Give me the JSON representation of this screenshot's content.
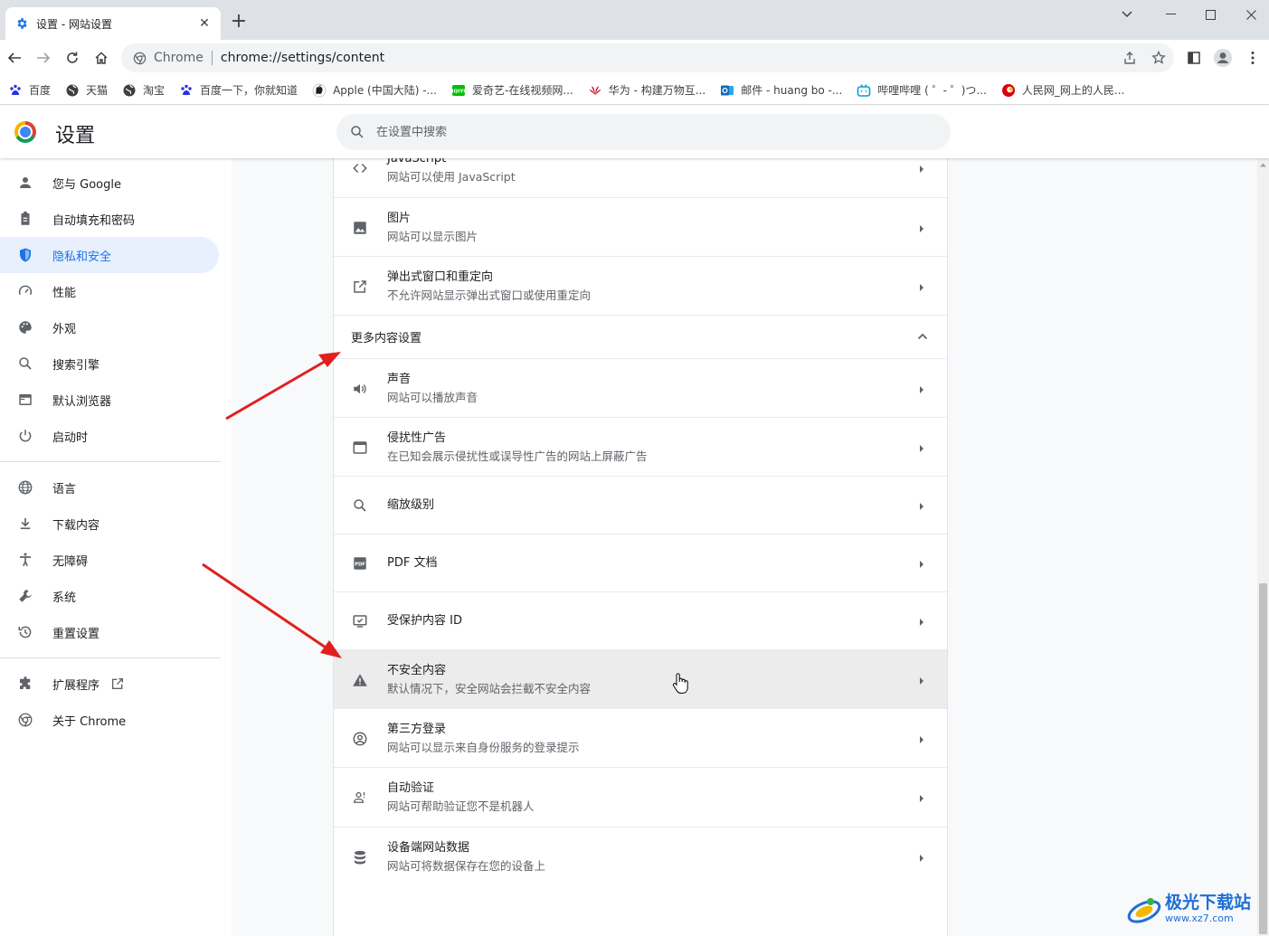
{
  "tab": {
    "title": "设置 - 网站设置",
    "close": "✕",
    "new_tab": "+"
  },
  "window_controls": {
    "dropdown": "⌄",
    "minimize": "—",
    "maximize": "☐",
    "close": "✕"
  },
  "omnibox": {
    "chip": "Chrome",
    "url": "chrome://settings/content"
  },
  "bookmarks": [
    {
      "label": "百度",
      "icon": "baidu-icon",
      "color": "#2932e1"
    },
    {
      "label": "天猫",
      "icon": "globe-icon",
      "color": "#3c4043"
    },
    {
      "label": "淘宝",
      "icon": "globe-icon",
      "color": "#3c4043"
    },
    {
      "label": "百度一下，你就知道",
      "icon": "baidu-icon",
      "color": "#2932e1"
    },
    {
      "label": "Apple (中国大陆) -...",
      "icon": "apple-icon",
      "color": "#1d1d1f"
    },
    {
      "label": "爱奇艺-在线视频网...",
      "icon": "iqiyi-icon",
      "color": "#00be06"
    },
    {
      "label": "华为 - 构建万物互...",
      "icon": "huawei-icon",
      "color": "#cf0a2c"
    },
    {
      "label": "邮件 - huang bo -...",
      "icon": "outlook-icon",
      "color": "#0f6cbd"
    },
    {
      "label": "哔哩哔哩 ( ゜- ゜)つ...",
      "icon": "bilibili-icon",
      "color": "#00a1d6"
    },
    {
      "label": "人民网_网上的人民...",
      "icon": "people-icon",
      "color": "#d7000f"
    }
  ],
  "header": {
    "title": "设置",
    "search_placeholder": "在设置中搜索"
  },
  "sidebar": {
    "items": [
      {
        "label": "您与 Google",
        "icon": "person-icon"
      },
      {
        "label": "自动填充和密码",
        "icon": "clipboard-icon"
      },
      {
        "label": "隐私和安全",
        "icon": "shield-icon",
        "selected": true
      },
      {
        "label": "性能",
        "icon": "speedometer-icon"
      },
      {
        "label": "外观",
        "icon": "palette-icon"
      },
      {
        "label": "搜索引擎",
        "icon": "search-icon"
      },
      {
        "label": "默认浏览器",
        "icon": "browser-icon"
      },
      {
        "label": "启动时",
        "icon": "power-icon"
      },
      {
        "label": "语言",
        "icon": "globe-icon"
      },
      {
        "label": "下载内容",
        "icon": "download-icon"
      },
      {
        "label": "无障碍",
        "icon": "accessibility-icon"
      },
      {
        "label": "系统",
        "icon": "wrench-icon"
      },
      {
        "label": "重置设置",
        "icon": "restore-icon"
      },
      {
        "label": "扩展程序",
        "icon": "puzzle-icon"
      },
      {
        "label": "关于 Chrome",
        "icon": "chrome-icon"
      }
    ]
  },
  "content": {
    "rows_top": [
      {
        "label": "JavaScript",
        "sub": "网站可以使用 JavaScript",
        "icon": "code-icon"
      },
      {
        "label": "图片",
        "sub": "网站可以显示图片",
        "icon": "image-icon"
      },
      {
        "label": "弹出式窗口和重定向",
        "sub": "不允许网站显示弹出式窗口或使用重定向",
        "icon": "open-in-new-icon"
      }
    ],
    "section_title": "更多内容设置",
    "rows_more": [
      {
        "label": "声音",
        "sub": "网站可以播放声音",
        "icon": "volume-icon"
      },
      {
        "label": "侵扰性广告",
        "sub": "在已知会展示侵扰性或误导性广告的网站上屏蔽广告",
        "icon": "ad-window-icon"
      },
      {
        "label": "缩放级别",
        "sub": "",
        "icon": "zoom-icon"
      },
      {
        "label": "PDF 文档",
        "sub": "",
        "icon": "pdf-icon"
      },
      {
        "label": "受保护内容 ID",
        "sub": "",
        "icon": "protected-content-icon"
      },
      {
        "label": "不安全内容",
        "sub": "默认情况下，安全网站会拦截不安全内容",
        "icon": "warning-icon",
        "hovered": true
      },
      {
        "label": "第三方登录",
        "sub": "网站可以显示来自身份服务的登录提示",
        "icon": "account-circle-icon"
      },
      {
        "label": "自动验证",
        "sub": "网站可帮助验证您不是机器人",
        "icon": "verified-user-icon"
      },
      {
        "label": "设备端网站数据",
        "sub": "网站可将数据保存在您的设备上",
        "icon": "database-icon"
      }
    ]
  },
  "watermark": {
    "title": "极光下载站",
    "url": "www.xz7.com"
  },
  "colors": {
    "accent": "#1a73e8",
    "selected_bg": "#e8f0fe",
    "annotation_arrow": "#e02020"
  }
}
